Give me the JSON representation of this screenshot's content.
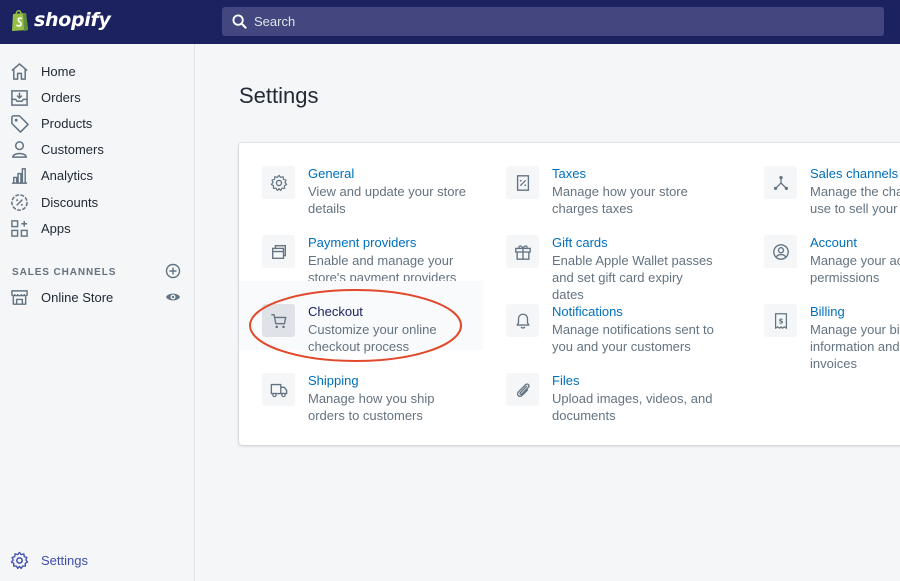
{
  "brand": {
    "name": "shopify"
  },
  "search": {
    "placeholder": "Search"
  },
  "nav": {
    "items": [
      {
        "label": "Home",
        "icon": "home-icon"
      },
      {
        "label": "Orders",
        "icon": "orders-icon"
      },
      {
        "label": "Products",
        "icon": "tag-icon"
      },
      {
        "label": "Customers",
        "icon": "person-icon"
      },
      {
        "label": "Analytics",
        "icon": "bar-chart-icon"
      },
      {
        "label": "Discounts",
        "icon": "discount-icon"
      },
      {
        "label": "Apps",
        "icon": "apps-icon"
      }
    ],
    "sales_channels_title": "SALES CHANNELS",
    "online_store": "Online Store",
    "settings": "Settings"
  },
  "page": {
    "title": "Settings"
  },
  "tiles": [
    {
      "title": "General",
      "desc": "View and update your store details",
      "icon": "gear-icon"
    },
    {
      "title": "Payment providers",
      "desc": "Enable and manage your store's payment providers",
      "icon": "payment-icon"
    },
    {
      "title": "Checkout",
      "desc": "Customize your online checkout process",
      "icon": "cart-icon",
      "highlighted": true
    },
    {
      "title": "Shipping",
      "desc": "Manage how you ship orders to customers",
      "icon": "truck-icon"
    },
    {
      "title": "Taxes",
      "desc": "Manage how your store charges taxes",
      "icon": "tax-icon"
    },
    {
      "title": "Gift cards",
      "desc": "Enable Apple Wallet passes and set gift card expiry dates",
      "icon": "gift-icon"
    },
    {
      "title": "Notifications",
      "desc": "Manage notifications sent to you and your customers",
      "icon": "bell-icon"
    },
    {
      "title": "Files",
      "desc": "Upload images, videos, and documents",
      "icon": "paperclip-icon"
    },
    {
      "title": "Sales channels",
      "desc": "Manage the channels you use to sell your products",
      "icon": "channels-icon"
    },
    {
      "title": "Account",
      "desc": "Manage your accounts and permissions",
      "icon": "account-icon"
    },
    {
      "title": "Billing",
      "desc": "Manage your billing information and view your invoices",
      "icon": "billing-icon"
    }
  ],
  "colors": {
    "topbar": "#1c2260",
    "link": "#006fbb",
    "annotation": "#e0492b"
  }
}
